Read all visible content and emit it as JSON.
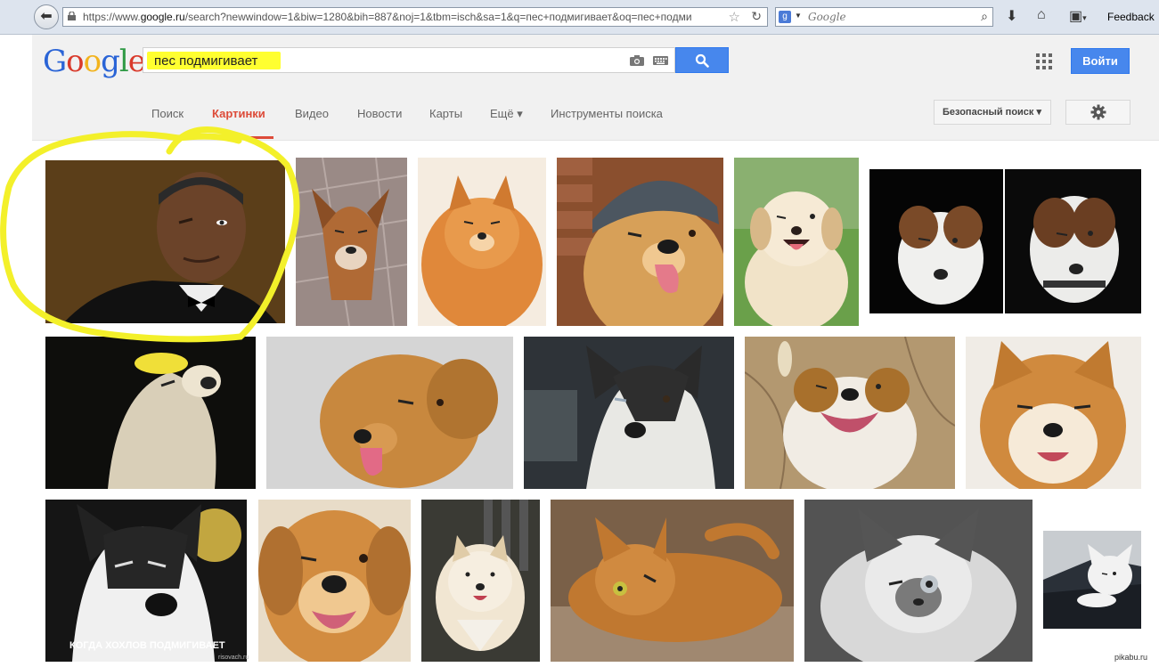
{
  "browser": {
    "url_prefix": "https://www.",
    "url_domain": "google.ru",
    "url_rest": "/search?newwindow=1&biw=1280&bih=887&noj=1&tbm=isch&sa=1&q=пес+подмигивает&oq=пес+подми",
    "search_placeholder": "Google",
    "feedback_label": "Feedback"
  },
  "google": {
    "logo_letters": [
      "G",
      "o",
      "o",
      "g",
      "l",
      "e"
    ],
    "logo_colors": [
      "#2a64d6",
      "#d93a2b",
      "#f2b31e",
      "#2a64d6",
      "#2f9a45",
      "#d93a2b"
    ],
    "query": "пес подмигивает",
    "login_label": "Войти",
    "tabs": [
      {
        "label": "Поиск"
      },
      {
        "label": "Картинки"
      },
      {
        "label": "Видео"
      },
      {
        "label": "Новости"
      },
      {
        "label": "Карты"
      },
      {
        "label": "Ещё ▾"
      },
      {
        "label": "Инструменты поиска"
      }
    ],
    "safe_search_label": "Безопасный поиск ▾",
    "accent": "#dd4b39",
    "button_blue": "#4787ed",
    "highlight_color": "#ffff30"
  },
  "results": {
    "caption_meme": "КОГДА ХОХЛОВ ПОДМИГИВАЕТ",
    "caption_site": "risovach.ru",
    "watermark": "pikabu.ru"
  }
}
